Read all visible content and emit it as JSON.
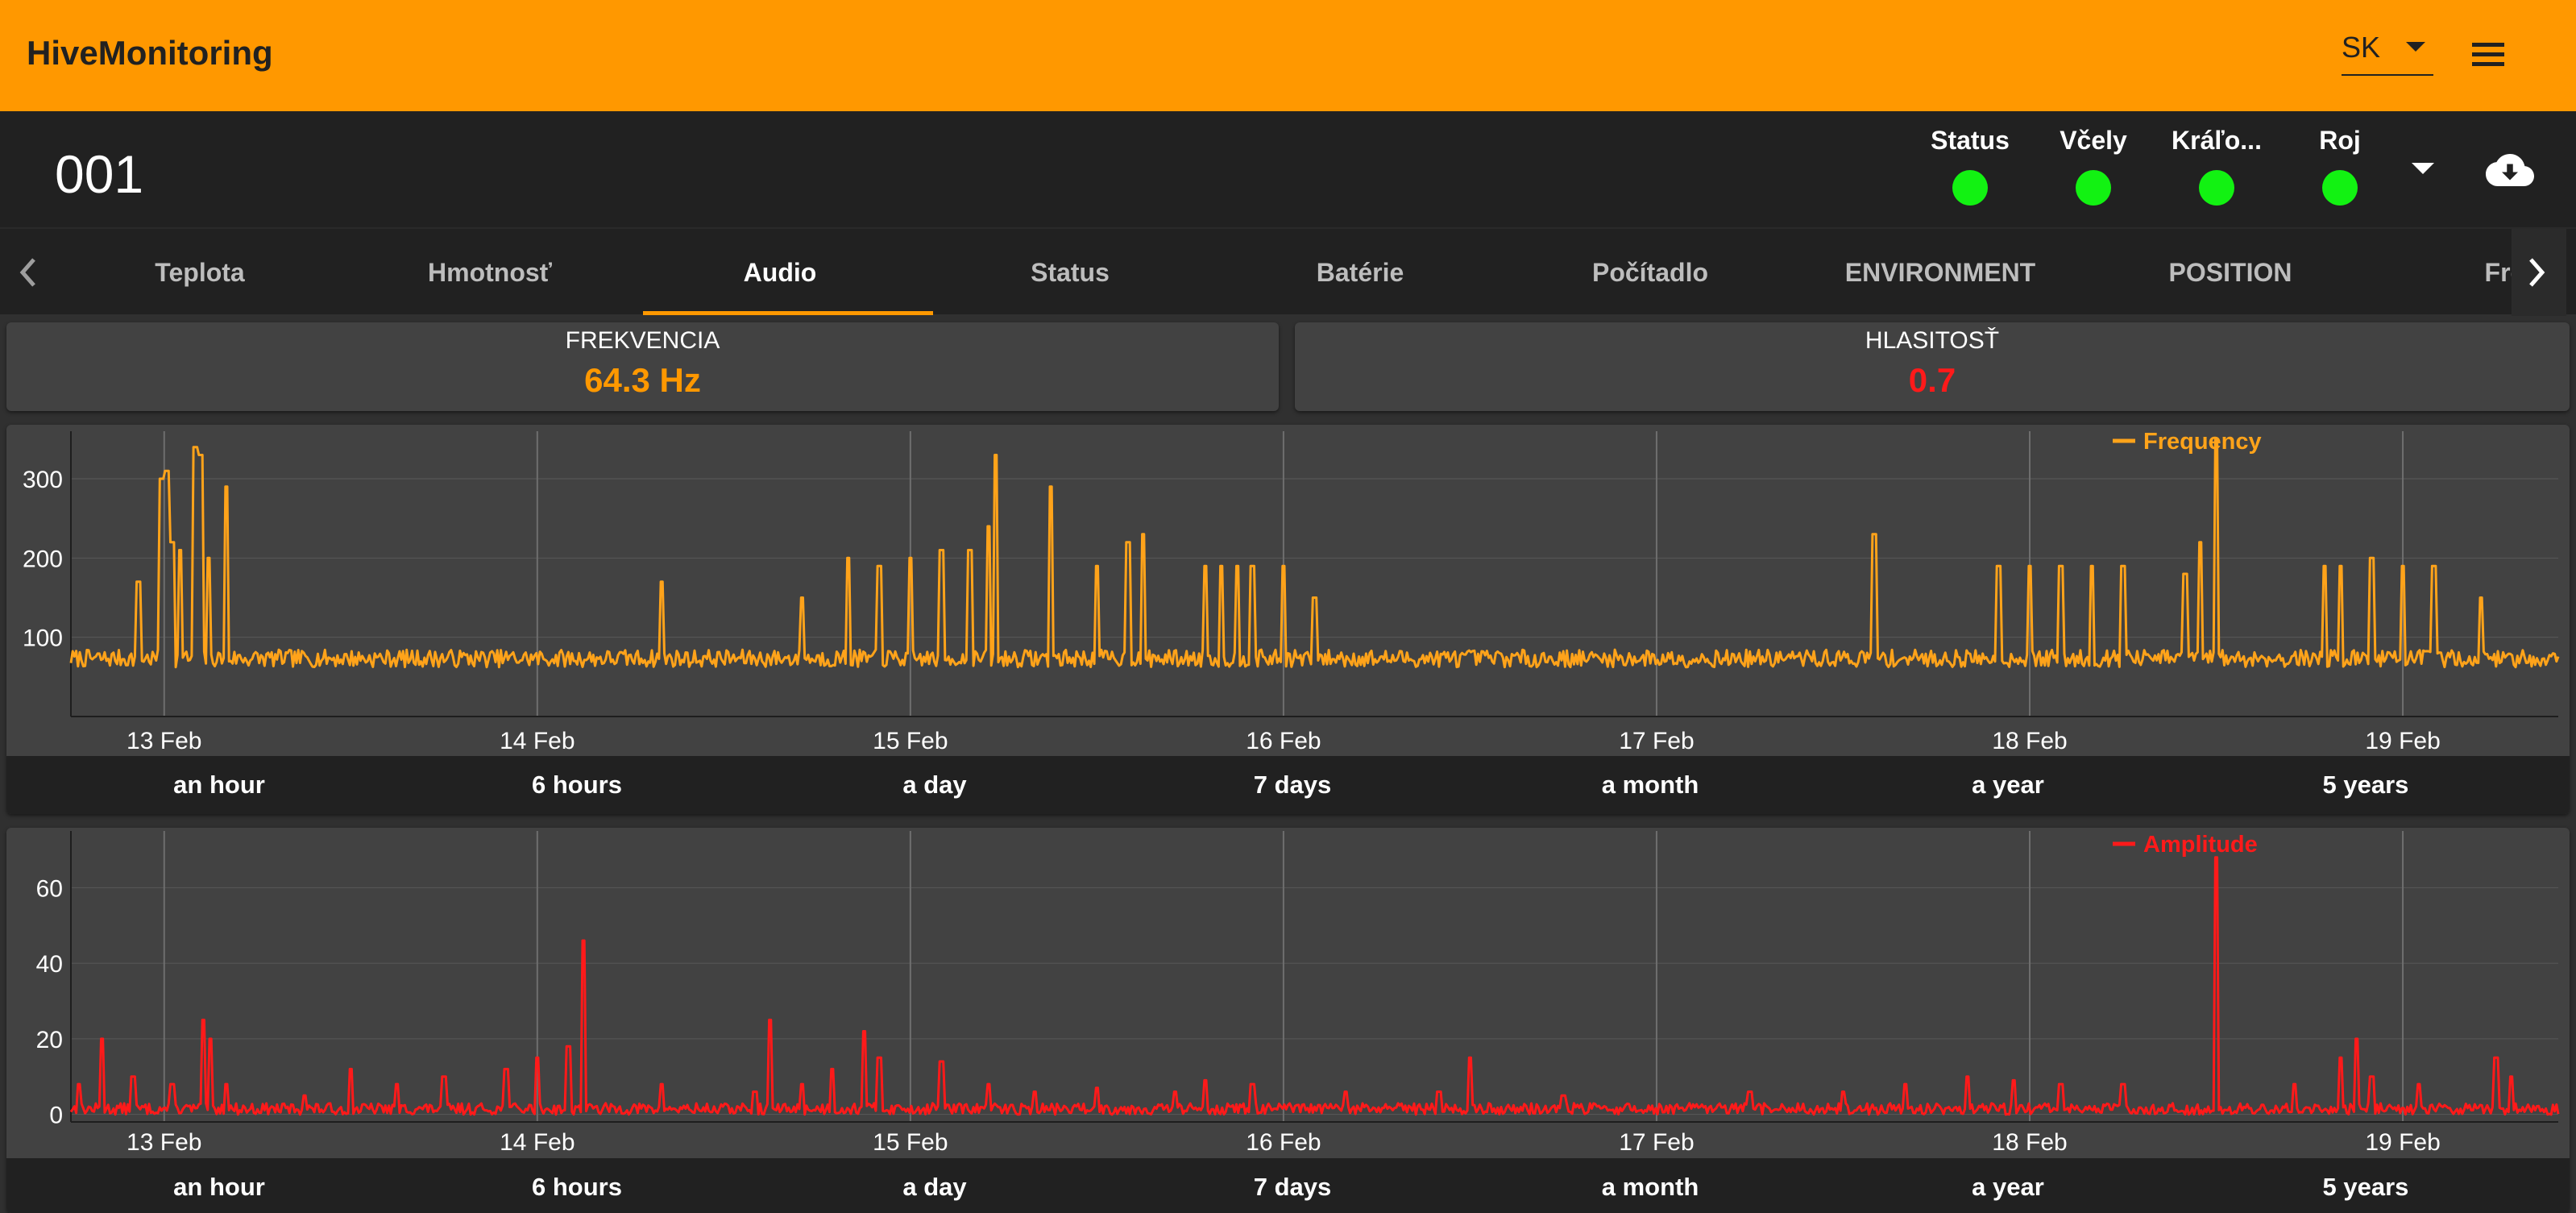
{
  "app": {
    "title": "HiveMonitoring"
  },
  "language": {
    "value": "SK"
  },
  "hive": {
    "id": "001"
  },
  "statuses": [
    {
      "label": "Status",
      "color": "#12f212"
    },
    {
      "label": "Včely",
      "color": "#12f212"
    },
    {
      "label": "Kráľo...",
      "color": "#12f212"
    },
    {
      "label": "Roj",
      "color": "#12f212"
    }
  ],
  "tabs": [
    {
      "label": "Teplota"
    },
    {
      "label": "Hmotnosť"
    },
    {
      "label": "Audio",
      "active": true
    },
    {
      "label": "Status"
    },
    {
      "label": "Batérie"
    },
    {
      "label": "Počítadlo"
    },
    {
      "label": "ENVIRONMENT"
    },
    {
      "label": "POSITION"
    },
    {
      "label": "Frequ"
    }
  ],
  "cards": {
    "frequency": {
      "title": "FREKVENCIA",
      "value": "64.3 Hz",
      "color": "#ff9800"
    },
    "loudness": {
      "title": "HLASITOSŤ",
      "value": "0.7",
      "color": "#ff1a1a"
    }
  },
  "range_buttons": [
    "an hour",
    "6 hours",
    "a day",
    "7 days",
    "a month",
    "a year",
    "5 years"
  ],
  "chart_data": [
    {
      "type": "line",
      "series": [
        {
          "name": "Frequency",
          "color": "#ffa31a"
        }
      ],
      "x_ticks": [
        "13 Feb",
        "14 Feb",
        "15 Feb",
        "16 Feb",
        "17 Feb",
        "18 Feb",
        "19 Feb"
      ],
      "x_range": [
        "12 Feb 18:00",
        "19 Feb 10:00"
      ],
      "y_ticks": [
        100,
        200,
        300
      ],
      "ylim": [
        0,
        360
      ],
      "baseline": 70,
      "spikes": [
        [
          "12 Feb 22:20",
          170
        ],
        [
          "12 Feb 23:50",
          300
        ],
        [
          "13 Feb 00:10",
          310
        ],
        [
          "13 Feb 00:30",
          220
        ],
        [
          "13 Feb 01:00",
          210
        ],
        [
          "13 Feb 02:00",
          340
        ],
        [
          "13 Feb 02:20",
          330
        ],
        [
          "13 Feb 02:50",
          200
        ],
        [
          "13 Feb 04:00",
          290
        ],
        [
          "14 Feb 08:00",
          170
        ],
        [
          "14 Feb 17:00",
          150
        ],
        [
          "14 Feb 20:00",
          200
        ],
        [
          "14 Feb 22:00",
          190
        ],
        [
          "15 Feb 00:00",
          200
        ],
        [
          "15 Feb 02:00",
          210
        ],
        [
          "15 Feb 03:50",
          210
        ],
        [
          "15 Feb 05:00",
          240
        ],
        [
          "15 Feb 05:30",
          330
        ],
        [
          "15 Feb 09:00",
          290
        ],
        [
          "15 Feb 12:00",
          190
        ],
        [
          "15 Feb 14:00",
          220
        ],
        [
          "15 Feb 15:00",
          230
        ],
        [
          "15 Feb 19:00",
          190
        ],
        [
          "15 Feb 20:00",
          190
        ],
        [
          "15 Feb 21:00",
          190
        ],
        [
          "15 Feb 22:00",
          190
        ],
        [
          "16 Feb 00:00",
          190
        ],
        [
          "16 Feb 02:00",
          150
        ],
        [
          "17 Feb 14:00",
          230
        ],
        [
          "17 Feb 22:00",
          190
        ],
        [
          "18 Feb 00:00",
          190
        ],
        [
          "18 Feb 02:00",
          190
        ],
        [
          "18 Feb 04:00",
          190
        ],
        [
          "18 Feb 06:00",
          190
        ],
        [
          "18 Feb 10:00",
          180
        ],
        [
          "18 Feb 11:00",
          220
        ],
        [
          "18 Feb 12:00",
          350
        ],
        [
          "18 Feb 19:00",
          190
        ],
        [
          "18 Feb 20:00",
          190
        ],
        [
          "18 Feb 22:00",
          200
        ],
        [
          "19 Feb 00:00",
          190
        ],
        [
          "19 Feb 02:00",
          190
        ],
        [
          "19 Feb 05:00",
          150
        ]
      ]
    },
    {
      "type": "line",
      "series": [
        {
          "name": "Amplitude",
          "color": "#ff1a1a"
        }
      ],
      "x_ticks": [
        "13 Feb",
        "14 Feb",
        "15 Feb",
        "16 Feb",
        "17 Feb",
        "18 Feb",
        "19 Feb"
      ],
      "x_range": [
        "12 Feb 18:00",
        "19 Feb 10:00"
      ],
      "y_ticks": [
        0,
        20,
        40,
        60
      ],
      "ylim": [
        -2,
        75
      ],
      "baseline": 1,
      "spikes": [
        [
          "12 Feb 18:30",
          8
        ],
        [
          "12 Feb 20:00",
          20
        ],
        [
          "12 Feb 22:00",
          10
        ],
        [
          "13 Feb 00:30",
          8
        ],
        [
          "13 Feb 02:30",
          25
        ],
        [
          "13 Feb 03:00",
          20
        ],
        [
          "13 Feb 04:00",
          8
        ],
        [
          "13 Feb 09:00",
          5
        ],
        [
          "13 Feb 12:00",
          12
        ],
        [
          "13 Feb 15:00",
          8
        ],
        [
          "13 Feb 18:00",
          10
        ],
        [
          "13 Feb 22:00",
          12
        ],
        [
          "14 Feb 00:00",
          15
        ],
        [
          "14 Feb 02:00",
          18
        ],
        [
          "14 Feb 03:00",
          46
        ],
        [
          "14 Feb 08:00",
          8
        ],
        [
          "14 Feb 14:00",
          6
        ],
        [
          "14 Feb 15:00",
          25
        ],
        [
          "14 Feb 17:00",
          8
        ],
        [
          "14 Feb 19:00",
          12
        ],
        [
          "14 Feb 21:00",
          22
        ],
        [
          "14 Feb 22:00",
          15
        ],
        [
          "15 Feb 02:00",
          14
        ],
        [
          "15 Feb 05:00",
          8
        ],
        [
          "15 Feb 08:00",
          6
        ],
        [
          "15 Feb 12:00",
          7
        ],
        [
          "15 Feb 17:00",
          6
        ],
        [
          "15 Feb 19:00",
          9
        ],
        [
          "15 Feb 22:00",
          8
        ],
        [
          "16 Feb 04:00",
          6
        ],
        [
          "16 Feb 10:00",
          6
        ],
        [
          "16 Feb 12:00",
          15
        ],
        [
          "16 Feb 18:00",
          5
        ],
        [
          "17 Feb 06:00",
          6
        ],
        [
          "17 Feb 12:00",
          6
        ],
        [
          "17 Feb 16:00",
          8
        ],
        [
          "17 Feb 20:00",
          10
        ],
        [
          "17 Feb 23:00",
          9
        ],
        [
          "18 Feb 02:00",
          8
        ],
        [
          "18 Feb 06:00",
          8
        ],
        [
          "18 Feb 12:00",
          68
        ],
        [
          "18 Feb 17:00",
          8
        ],
        [
          "18 Feb 20:00",
          15
        ],
        [
          "18 Feb 21:00",
          20
        ],
        [
          "18 Feb 22:00",
          10
        ],
        [
          "19 Feb 01:00",
          8
        ],
        [
          "19 Feb 06:00",
          15
        ],
        [
          "19 Feb 07:00",
          10
        ]
      ]
    }
  ]
}
